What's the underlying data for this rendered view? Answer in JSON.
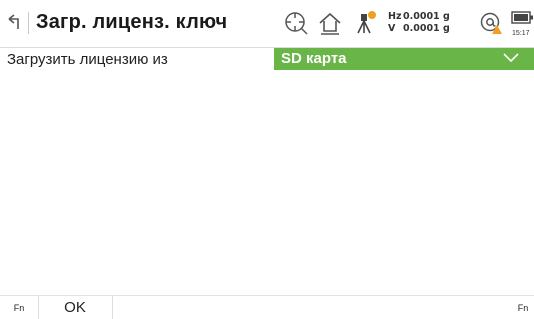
{
  "header": {
    "title": "Загр. лиценз. ключ",
    "icons": [
      "back-arrow-icon",
      "crosshair-target-icon",
      "home-icon",
      "instrument-tripod-icon",
      "at-sign-warning-icon",
      "battery-icon"
    ],
    "hz_label": "Hz",
    "hz_value": "0.0001 g",
    "v_label": "V",
    "v_value": "0.0001 g",
    "time": "15:17"
  },
  "form": {
    "label": "Загрузить лицензию из",
    "selected": "SD карта"
  },
  "footer": {
    "fn_left": "Fn",
    "ok": "OK",
    "fn_right": "Fn"
  },
  "colors": {
    "accent": "#6ab547",
    "warning": "#f0a020"
  }
}
